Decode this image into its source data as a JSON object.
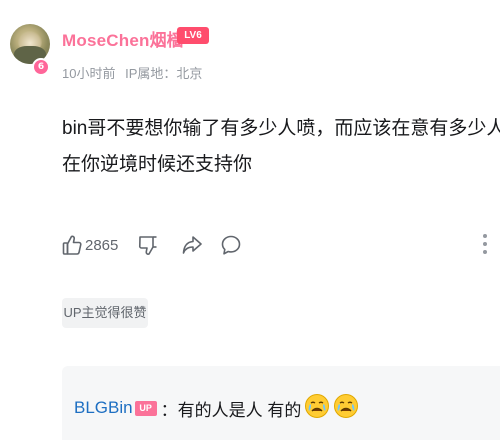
{
  "comment": {
    "user": {
      "name": "MoseChen",
      "name_suffix": "烟樯",
      "level_badge": "6",
      "lv_tag": "LV6"
    },
    "meta": {
      "time": "10小时前",
      "ip_location": "IP属地：北京"
    },
    "text_lines": [
      "bin哥不要想你输了有多少人喷，而应该在意有多少人",
      "在你逆境时候还支持你"
    ],
    "actions": {
      "like_count": "2865"
    },
    "up_liked_label": "UP主觉得很赞"
  },
  "reply": {
    "user": "BLGBin",
    "up_tag": "UP",
    "text": "：有的人是人 有的"
  },
  "icons": {
    "like": "thumbs-up-icon",
    "dislike": "thumbs-down-icon",
    "share": "share-arrow-icon",
    "reply": "speech-bubble-icon",
    "more": "vertical-dots-icon",
    "emoji": "crying-face-emoji"
  },
  "colors": {
    "username": "#fb7299",
    "lv_tag": "#ff4d6d",
    "meta": "#9499a0",
    "reply_user": "#1e6fc2",
    "reply_bg": "#f6f7f8",
    "up_badge_bg": "#f1f2f3"
  }
}
